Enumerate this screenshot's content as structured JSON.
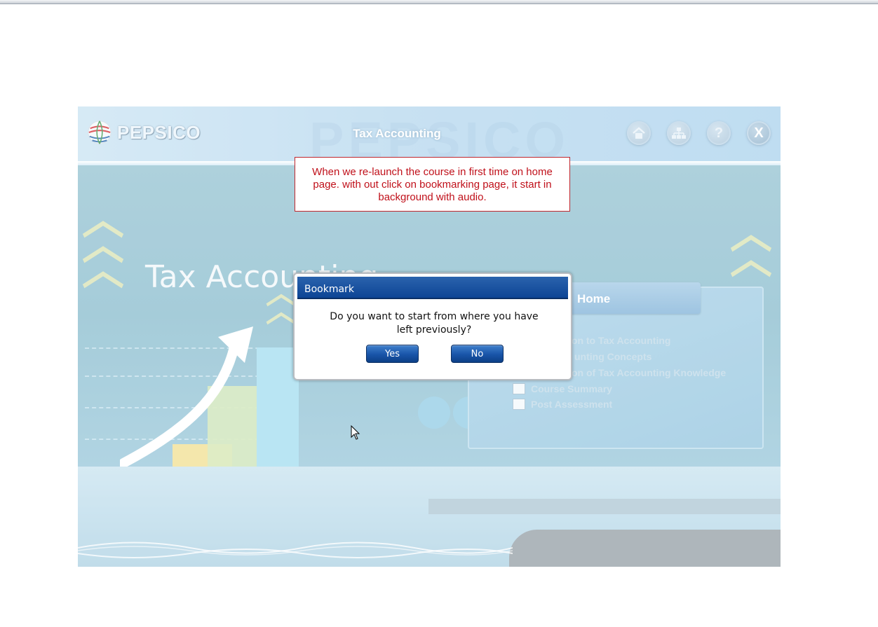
{
  "header": {
    "logo_text": "PEPSICO",
    "course_title": "Tax Accounting",
    "buttons": {
      "home": {
        "icon": "home-icon"
      },
      "menu": {
        "icon": "sitemap-icon"
      },
      "help": {
        "icon": "help-icon",
        "glyph": "?"
      },
      "close": {
        "icon": "close-icon",
        "glyph": "X"
      }
    }
  },
  "scene": {
    "title": "Tax Accounting"
  },
  "home_panel": {
    "label": "Home",
    "items": [
      {
        "text": "ion to Tax Accounting",
        "checkbox": false
      },
      {
        "text": "unting Concepts",
        "checkbox": false
      },
      {
        "text": "on of Tax Accounting Knowledge",
        "checkbox": false
      },
      {
        "text": "Course Summary",
        "checkbox": true
      },
      {
        "text": "Post Assessment",
        "checkbox": true
      }
    ]
  },
  "annotation": {
    "text": "When we re-launch the course in first time on home page. with out click on bookmarking page, it start in background with audio."
  },
  "dialog": {
    "title": "Bookmark",
    "message": "Do you want to start from where you have left previously?",
    "yes_label": "Yes",
    "no_label": "No"
  },
  "colors": {
    "dialog_title_bg": "#0d4595",
    "annotation_text": "#c0101a",
    "button_blue": "#1854a8"
  }
}
